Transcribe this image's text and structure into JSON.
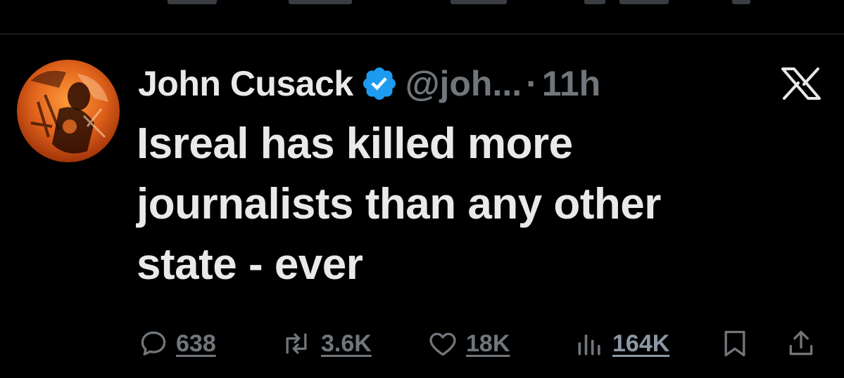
{
  "tweet": {
    "author": {
      "name": "John Cusack",
      "handle": "@joh...",
      "verified": true
    },
    "separator": "·",
    "time": "11h",
    "text": "Isreal has killed more\njournalists  than any other\nstate  - ever"
  },
  "actions": {
    "replies": "638",
    "reposts": "3.6K",
    "likes": "18K",
    "views": "164K"
  },
  "icons": {
    "reply": "reply-icon",
    "repost": "repost-icon",
    "like": "heart-icon",
    "views": "views-icon",
    "bookmark": "bookmark-icon",
    "share": "share-icon",
    "platform": "x-logo-icon",
    "verified": "verified-badge-icon"
  },
  "colors": {
    "background": "#000000",
    "primary_text": "#e7e9ea",
    "secondary_text": "#71767b",
    "verified_blue": "#1d9bf0",
    "divider": "#2f3336"
  }
}
